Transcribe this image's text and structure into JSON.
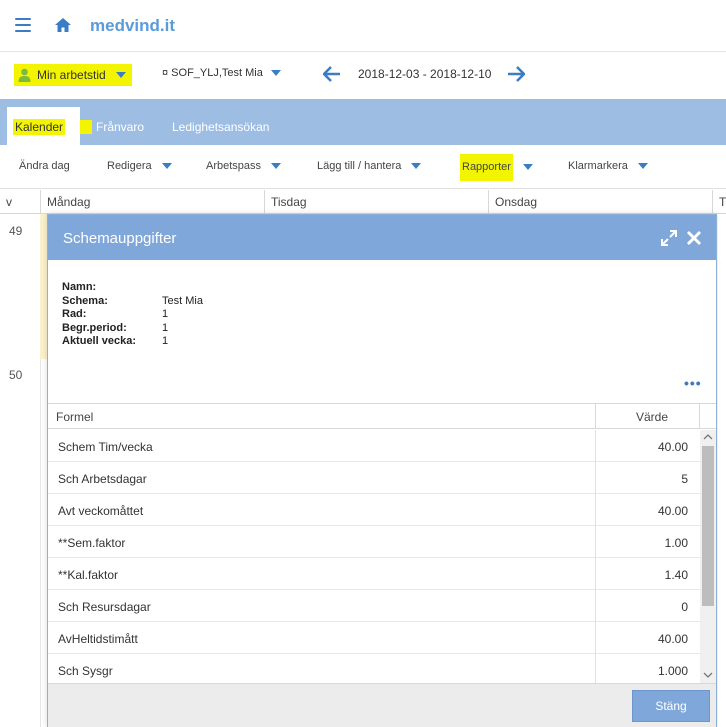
{
  "header": {
    "brand": "medvind.it"
  },
  "row2": {
    "user_select_label": "Min arbetstid",
    "schedule_select_label": "¤ SOF_YLJ,Test Mia",
    "date_range": "2018-12-03 - 2018-12-10"
  },
  "tabs": [
    {
      "label": "Kalender"
    },
    {
      "label": "Frånvaro"
    },
    {
      "label": "Ledighetsansökan"
    }
  ],
  "toolbar": [
    {
      "label": "Ändra dag"
    },
    {
      "label": "Redigera"
    },
    {
      "label": "Arbetspass"
    },
    {
      "label": "Lägg till / hantera"
    },
    {
      "label": "Rapporter"
    },
    {
      "label": "Klarmarkera"
    }
  ],
  "calendar": {
    "week_col": "v",
    "days": [
      "Måndag",
      "Tisdag",
      "Onsdag",
      "T"
    ],
    "weeks": [
      "49",
      "50"
    ]
  },
  "modal": {
    "title": "Schemauppgifter",
    "info": [
      {
        "key": "Namn:",
        "value": ""
      },
      {
        "key": "Schema:",
        "value": "Test Mia"
      },
      {
        "key": "Rad:",
        "value": "1"
      },
      {
        "key": "Begr.period:",
        "value": "1"
      },
      {
        "key": "Aktuell vecka:",
        "value": "1"
      }
    ],
    "table_headers": {
      "formel": "Formel",
      "varde": "Värde"
    },
    "rows": [
      {
        "formel": "Schem Tim/vecka",
        "varde": "40.00"
      },
      {
        "formel": "Sch Arbetsdagar",
        "varde": "5"
      },
      {
        "formel": "Avt veckomåttet",
        "varde": "40.00"
      },
      {
        "formel": "**Sem.faktor",
        "varde": "1.00"
      },
      {
        "formel": "**Kal.faktor",
        "varde": "1.40"
      },
      {
        "formel": "Sch Resursdagar",
        "varde": "0"
      },
      {
        "formel": "AvHeltidstimått",
        "varde": "40.00"
      },
      {
        "formel": "Sch Sysgr",
        "varde": "1.000"
      }
    ],
    "close_label": "Stäng"
  },
  "colors": {
    "accent": "#3b7dc4",
    "tab_bar": "#9dbde3",
    "modal_header": "#7fa7d9",
    "highlight": "#f3f500"
  }
}
